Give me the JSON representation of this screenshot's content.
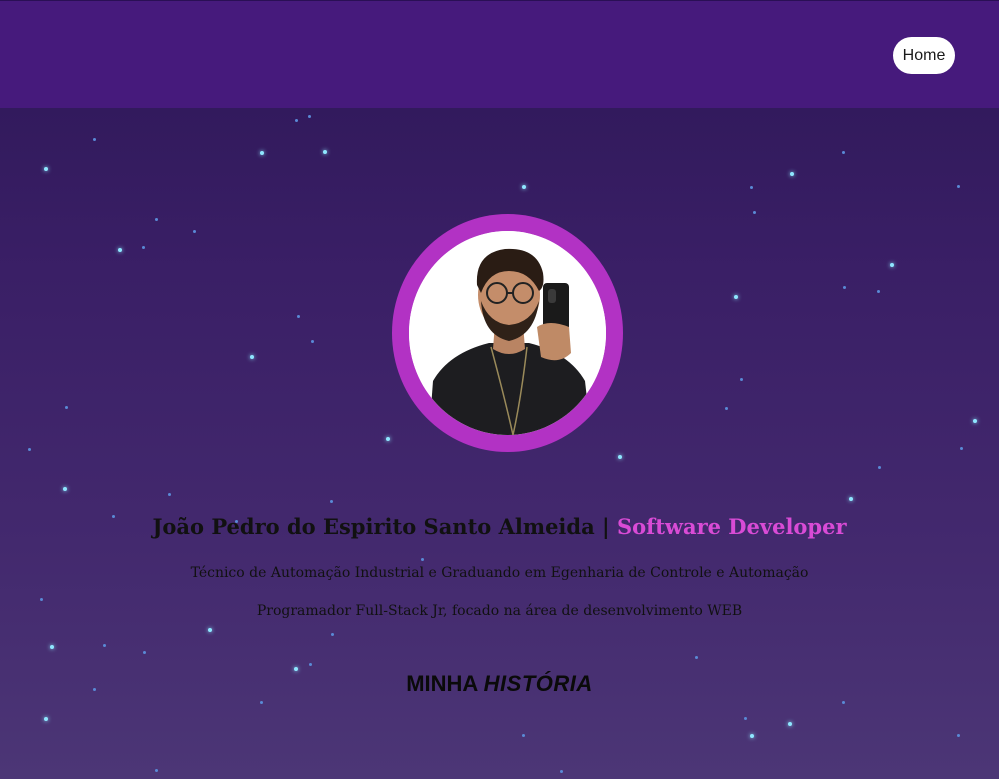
{
  "nav": {
    "home_label": "Home"
  },
  "profile": {
    "name": "João Pedro do Espirito Santo Almeida",
    "separator": "|",
    "role": "Software Developer",
    "subtitle_1": "Técnico de Automação Industrial e Graduando em Egenharia de Controle e Automação",
    "subtitle_2": "Programador Full-Stack Jr, focado na área de desenvolvimento WEB"
  },
  "section": {
    "title_plain": "MINHA",
    "title_emphasis": "HISTÓRIA"
  },
  "colors": {
    "topbar": "#461a7c",
    "avatar_ring": "#b232c4",
    "role_accent": "#d94bd6",
    "star": "#8fe7ff"
  }
}
